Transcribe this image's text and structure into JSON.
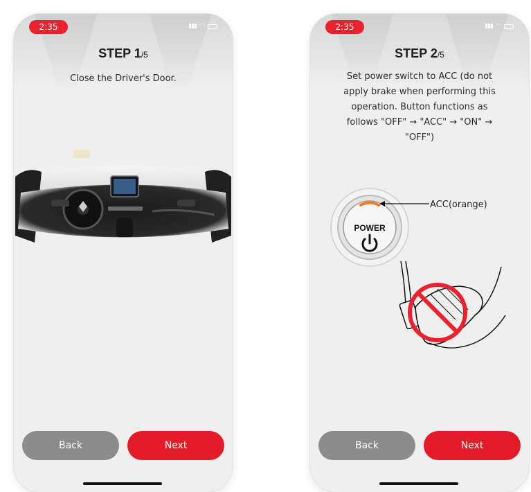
{
  "screens": [
    {
      "status": {
        "time": "2:35"
      },
      "step": {
        "label": "STEP 1",
        "total": "/5"
      },
      "instruction": "Close the Driver's Door.",
      "buttons": {
        "back": "Back",
        "next": "Next"
      }
    },
    {
      "status": {
        "time": "2:35"
      },
      "step": {
        "label": "STEP 2",
        "total": "/5"
      },
      "instruction_lines": [
        "Set power switch to ACC (do not",
        "apply brake when performing this",
        "operation. Button functions as",
        "follows \"OFF\" → \"ACC\" → \"ON\" →",
        "\"OFF\")"
      ],
      "power_button": {
        "label": "POWER",
        "callout": "ACC(orange)"
      },
      "buttons": {
        "back": "Back",
        "next": "Next"
      }
    }
  ],
  "colors": {
    "accent": "#e41b29",
    "back_button": "#8c8c8c",
    "screen_bg": "#efefef",
    "acc_indicator": "#f07a21"
  },
  "icons": [
    "signal-icon",
    "wifi-icon",
    "battery-icon",
    "power-icon",
    "no-brake-icon"
  ]
}
